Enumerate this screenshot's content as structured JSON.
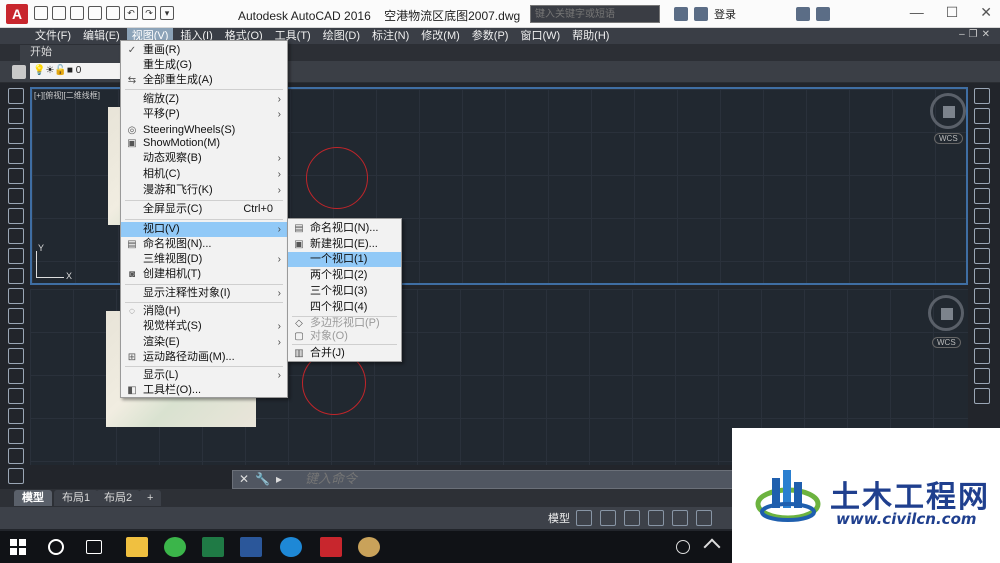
{
  "app": {
    "title": "Autodesk AutoCAD 2016",
    "filename": "空港物流区底图2007.dwg",
    "search_placeholder": "键入关键字或短语",
    "login": "登录"
  },
  "menubar": [
    "文件(F)",
    "编辑(E)",
    "视图(V)",
    "插入(I)",
    "格式(O)",
    "工具(T)",
    "绘图(D)",
    "标注(N)",
    "修改(M)",
    "参数(P)",
    "窗口(W)",
    "帮助(H)"
  ],
  "start_tab": "开始",
  "layer": {
    "name": "0"
  },
  "viewport": {
    "label": "[+][俯视][二维线框]",
    "wcs": "WCS",
    "axis_y": "Y",
    "axis_x": "X"
  },
  "view_menu": {
    "items": [
      {
        "label": "重画(R)",
        "icon": "pencil-icon"
      },
      {
        "label": "重生成(G)"
      },
      {
        "label": "全部重生成(A)",
        "icon": "regen-icon"
      },
      {
        "label": "缩放(Z)",
        "submenu": true
      },
      {
        "label": "平移(P)",
        "submenu": true
      },
      {
        "label": "SteeringWheels(S)",
        "icon": "wheel-icon"
      },
      {
        "label": "ShowMotion(M)",
        "icon": "showmotion-icon"
      },
      {
        "label": "动态观察(B)",
        "submenu": true
      },
      {
        "label": "相机(C)",
        "submenu": true
      },
      {
        "label": "漫游和飞行(K)",
        "submenu": true
      },
      {
        "label": "全屏显示(C)",
        "shortcut": "Ctrl+0"
      },
      {
        "label": "视口(V)",
        "submenu": true
      },
      {
        "label": "命名视图(N)...",
        "icon": "named-view-icon"
      },
      {
        "label": "三维视图(D)",
        "submenu": true
      },
      {
        "label": "创建相机(T)",
        "icon": "camera-icon"
      },
      {
        "label": "显示注释性对象(I)",
        "submenu": true
      },
      {
        "label": "消隐(H)",
        "icon": "hide-icon"
      },
      {
        "label": "视觉样式(S)",
        "submenu": true
      },
      {
        "label": "渲染(E)",
        "submenu": true
      },
      {
        "label": "运动路径动画(M)...",
        "icon": "motion-path-icon"
      },
      {
        "label": "显示(L)",
        "submenu": true
      },
      {
        "label": "工具栏(O)...",
        "icon": "toolbar-icon"
      }
    ]
  },
  "viewport_submenu": {
    "items": [
      {
        "label": "命名视口(N)..."
      },
      {
        "label": "新建视口(E)..."
      },
      {
        "label": "一个视口(1)"
      },
      {
        "label": "两个视口(2)"
      },
      {
        "label": "三个视口(3)"
      },
      {
        "label": "四个视口(4)"
      },
      {
        "label": "多边形视口(P)",
        "disabled": true
      },
      {
        "label": "对象(O)",
        "disabled": true
      },
      {
        "label": "合并(J)"
      }
    ]
  },
  "command": {
    "placeholder": "键入命令"
  },
  "layout_tabs": [
    "模型",
    "布局1",
    "布局2",
    "+"
  ],
  "status": {
    "model": "模型"
  },
  "watermark": {
    "title": "土木工程网",
    "url": "www.civilcn.com"
  },
  "colors": {
    "accent_highlight": "#91c9f7",
    "circle": "#c0252a",
    "viewport_border": "#3f6ea3"
  }
}
